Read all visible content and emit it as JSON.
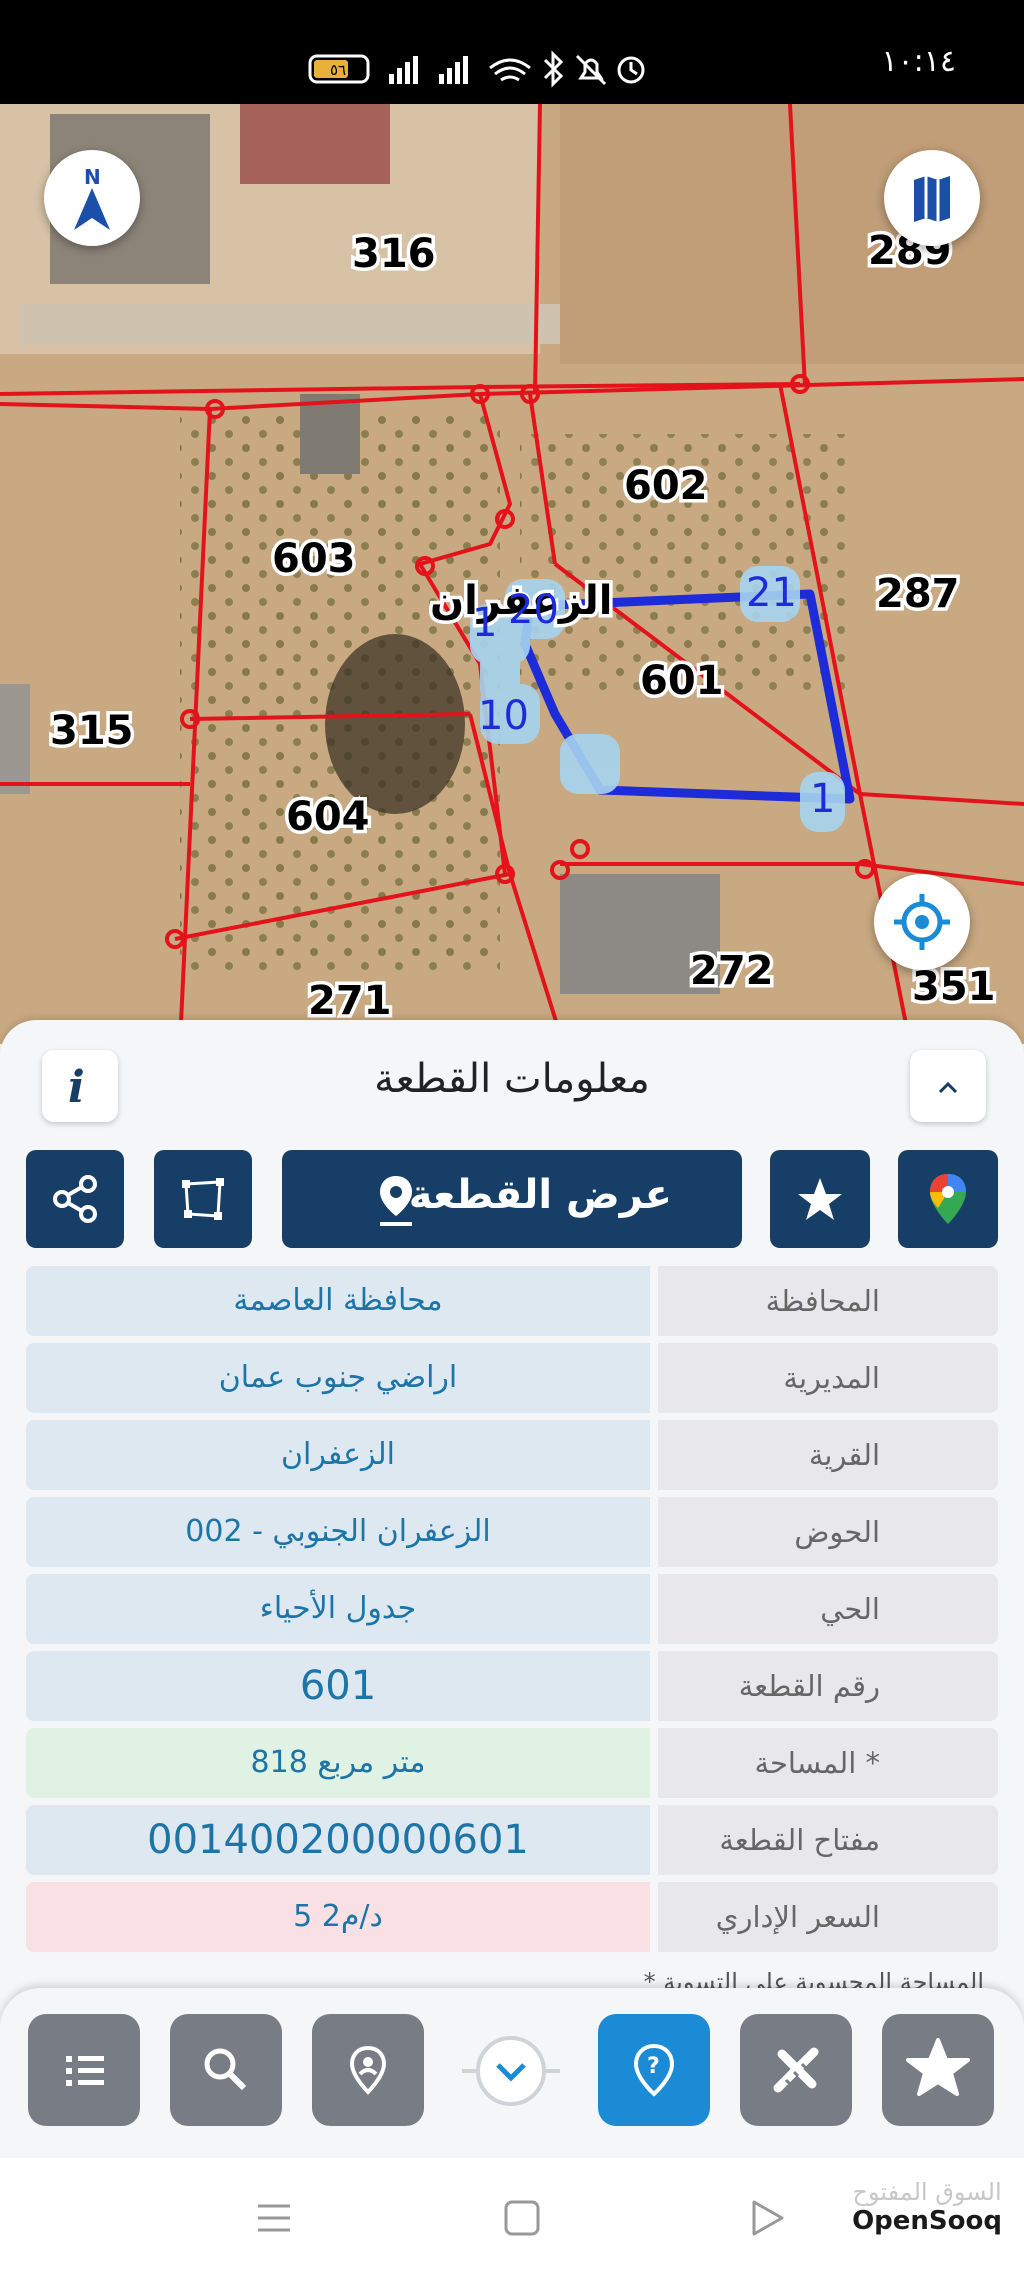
{
  "status_bar": {
    "time": "١٠:١٤",
    "battery": "٥٦"
  },
  "map": {
    "plot_labels": [
      "316",
      "289",
      "602",
      "287",
      "603",
      "601",
      "315",
      "604",
      "272",
      "271",
      "351"
    ],
    "vertex_labels": [
      "20",
      "21",
      "1",
      "10",
      "1"
    ],
    "area_name_partial": "الزعفران"
  },
  "panel": {
    "title": "معلومات القطعة",
    "show_plot_label": "عرض القطعة",
    "rows": [
      {
        "label": "المحافظة",
        "value": "محافظة العاصمة"
      },
      {
        "label": "المديرية",
        "value": "اراضي جنوب عمان"
      },
      {
        "label": "القرية",
        "value": "الزعفران"
      },
      {
        "label": "الحوض",
        "value": "الزعفران الجنوبي - 002"
      },
      {
        "label": "الحي",
        "value": "جدول الأحياء"
      },
      {
        "label": "رقم القطعة",
        "value": "601"
      },
      {
        "label": "المساحة *",
        "value": "818  متر مربع"
      },
      {
        "label": "مفتاح القطعة",
        "value": "001400200000601"
      },
      {
        "label": "السعر الإداري",
        "value": "5 د/م2"
      }
    ],
    "footnote_partial": "* المساحة المحسوبة على التسوية"
  },
  "colors": {
    "primary": "#173e66",
    "accent": "#1a8bd4",
    "boundary": "#e3121b",
    "selection": "#1e2bd8"
  },
  "watermark": {
    "arabic": "السوق المفتوح",
    "latin": "OpenSooq"
  }
}
